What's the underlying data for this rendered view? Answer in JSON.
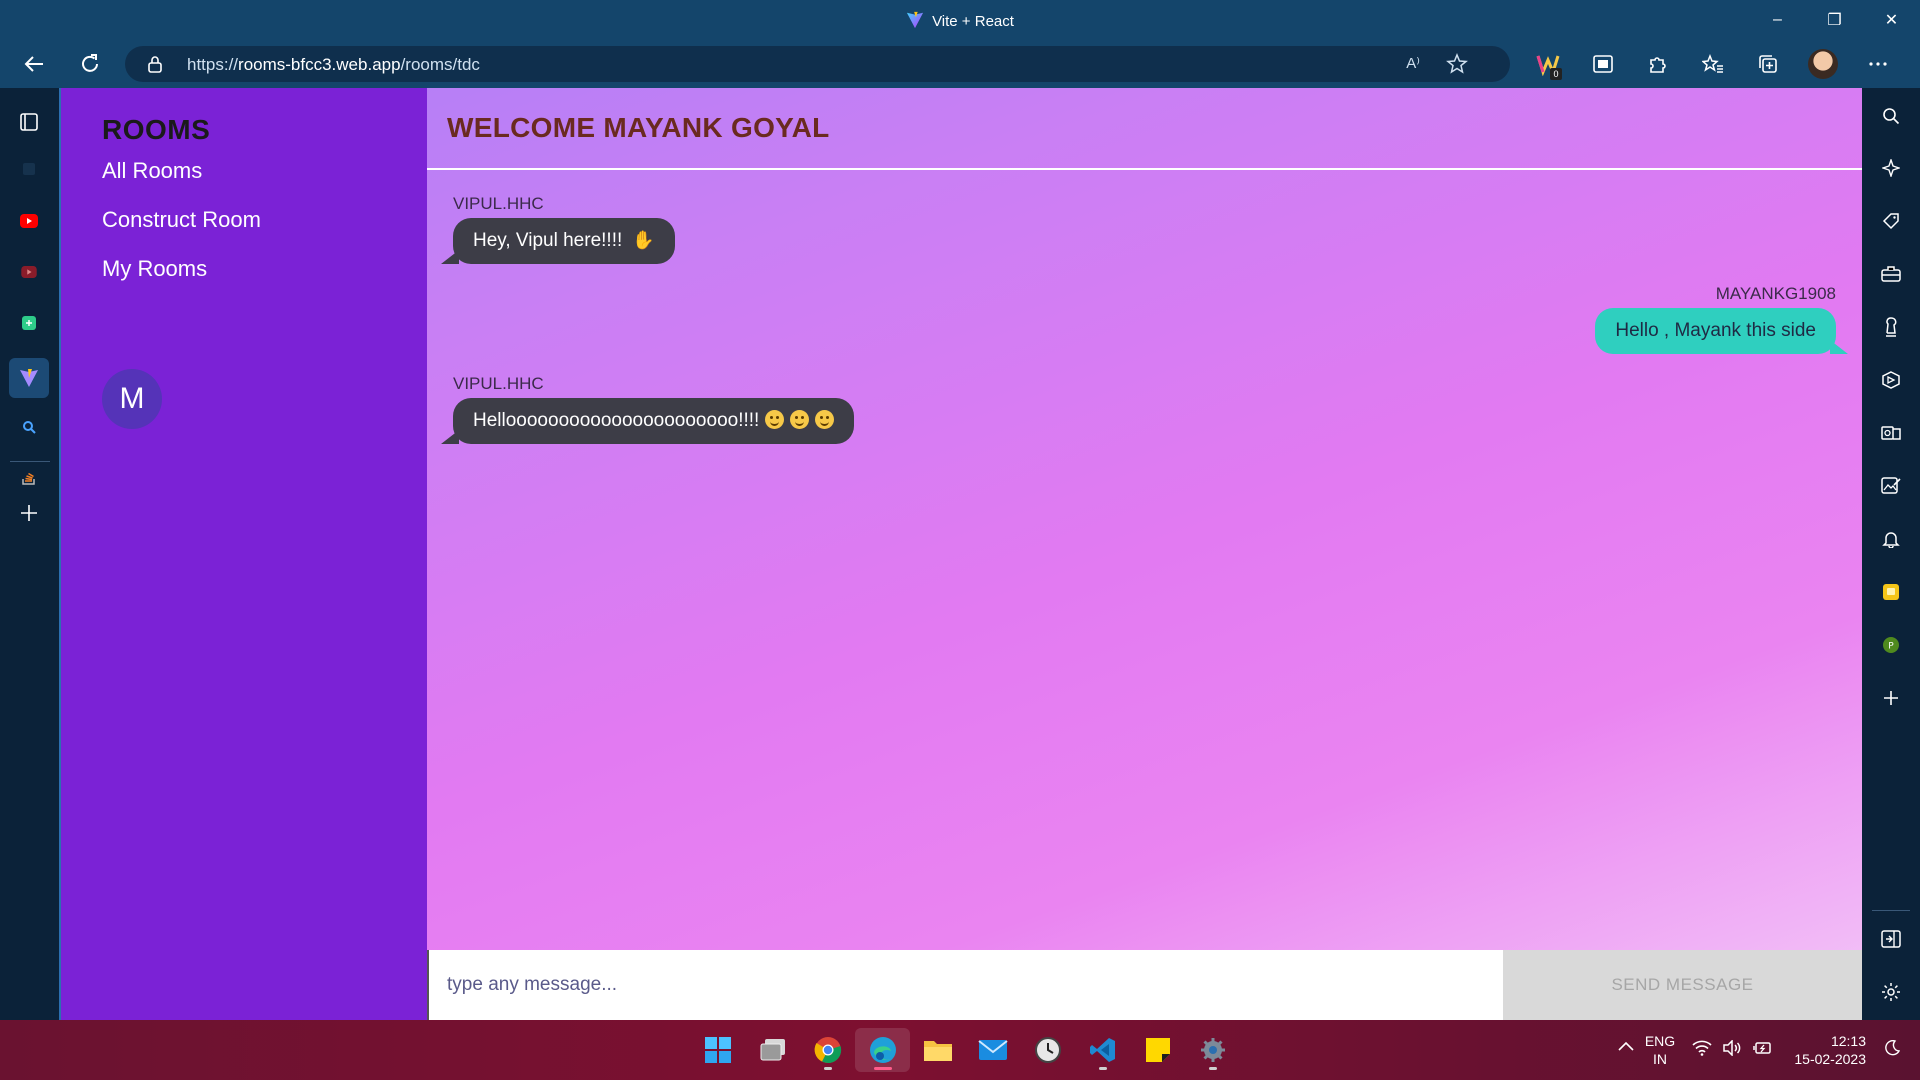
{
  "browser": {
    "tab_title": "Vite + React",
    "url_prefix": "https://",
    "url_host": "rooms-bfcc3.web.app",
    "url_path": "/rooms/tdc",
    "read_aloud": "A⁾",
    "extension_badge": "0",
    "window_controls": {
      "minimize": "–",
      "restore": "❐",
      "close": "✕"
    }
  },
  "app": {
    "sidebar": {
      "title": "ROOMS",
      "links": [
        "All Rooms",
        "Construct Room",
        "My Rooms"
      ],
      "avatar_letter": "M"
    },
    "header": {
      "title": "WELCOME MAYANK GOYAL"
    },
    "messages": [
      {
        "sender": "VIPUL.HHC",
        "text": "Hey, Vipul here!!!!",
        "direction": "in"
      },
      {
        "sender": "MAYANKG1908",
        "text": "Hello , Mayank this side",
        "direction": "out"
      },
      {
        "sender": "VIPUL.HHC",
        "text": "Helloooooooooooooooooooooo!!!!",
        "direction": "in"
      }
    ],
    "composer": {
      "placeholder": "type any message...",
      "value": "",
      "send_label": "SEND MESSAGE"
    },
    "colors": {
      "sidebar": "#7b22d6",
      "accent_out": "#2fcfbf",
      "bubble_in": "#3d3d47",
      "header_text": "#6a2a20"
    }
  },
  "taskbar": {
    "language": "ENG",
    "region": "IN",
    "time": "12:13",
    "date": "15-02-2023"
  }
}
